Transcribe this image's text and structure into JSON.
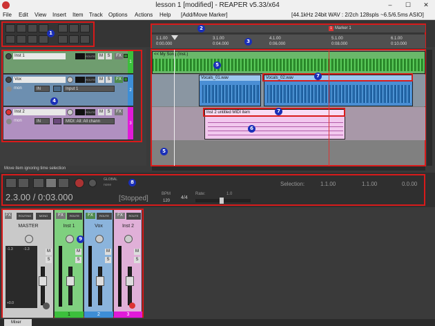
{
  "window": {
    "title": "lesson 1 [modified] - REAPER v5.33/x64",
    "controls": [
      "–",
      "☐",
      "✕"
    ]
  },
  "menu": {
    "items": [
      "File",
      "Edit",
      "View",
      "Insert",
      "Item",
      "Track",
      "Options",
      "Actions",
      "Help"
    ],
    "action_hint": "[Add/Move Marker]",
    "audio_status": "[44.1kHz 24bit WAV : 2/2ch 128spls ~6.5/6.5ms ASIO]"
  },
  "callouts": [
    "1",
    "2",
    "3",
    "4",
    "5",
    "6",
    "6",
    "6",
    "7",
    "7",
    "8",
    "9"
  ],
  "marker": {
    "label": "Marker 1",
    "number": "1"
  },
  "ruler": {
    "bars": [
      "1.1.00",
      "2.1.00",
      "3.1.00",
      "4.1.00",
      "5.1.00",
      "6.1.00"
    ],
    "times": [
      "0:00.000",
      "0:02.000",
      "0:04.000",
      "0:06.000",
      "0:08.000",
      "0:10.000"
    ]
  },
  "tracks": [
    {
      "name": "Inst 1",
      "number": "1",
      "color": "#5bbf5b",
      "input": ""
    },
    {
      "name": "Vox",
      "number": "2",
      "color": "#3d8ed6",
      "input": "Input 1",
      "io": "IN",
      "mon": "mon"
    },
    {
      "name": "Inst 2",
      "number": "3",
      "color": "#e01ad8",
      "input": "MIDI: All: All chann",
      "io": "IN",
      "mon": "mon"
    }
  ],
  "track_buttons": {
    "mute": "M",
    "solo": "S",
    "fx": "FX",
    "route": "ROUTE"
  },
  "items": {
    "song": "<< My Song (Inst.)",
    "vocal1": "Vocals_01.wav",
    "vocal2": "Vocals_02.wav",
    "midi": "Inst 2 untitled MIDI item"
  },
  "status_message": "Move item ignoring time selection",
  "transport": {
    "position": "2.3.00 / 0:03.000",
    "state": "[Stopped]",
    "bpm_label": "BPM",
    "bpm": "120",
    "time_sig": "4/4",
    "rate_label": "Rate:",
    "rate": "1.0",
    "global_label": "GLOBAL",
    "none_label": "none",
    "selection_label": "Selection:",
    "selection_start": "1.1.00",
    "selection_end": "1.1.00",
    "selection_length": "0.0.00"
  },
  "mixer": {
    "channels": [
      {
        "name": "MASTER",
        "number": "",
        "color": "#c9c9c9",
        "routing": "ROUTING",
        "mono": "MONO"
      },
      {
        "name": "Inst 1",
        "number": "1",
        "color": "#5bbf5b"
      },
      {
        "name": "Vox",
        "number": "2",
        "color": "#3d8ed6"
      },
      {
        "name": "Inst 2",
        "number": "3",
        "color": "#e01ad8"
      }
    ],
    "scale": [
      "-1.3",
      "-1.3",
      "12",
      "6",
      "0",
      "-6",
      "-12",
      "-18",
      "-24",
      "-30",
      "-42",
      "-54",
      "-inf",
      "+0.0"
    ],
    "tab_label": "Mixer"
  }
}
